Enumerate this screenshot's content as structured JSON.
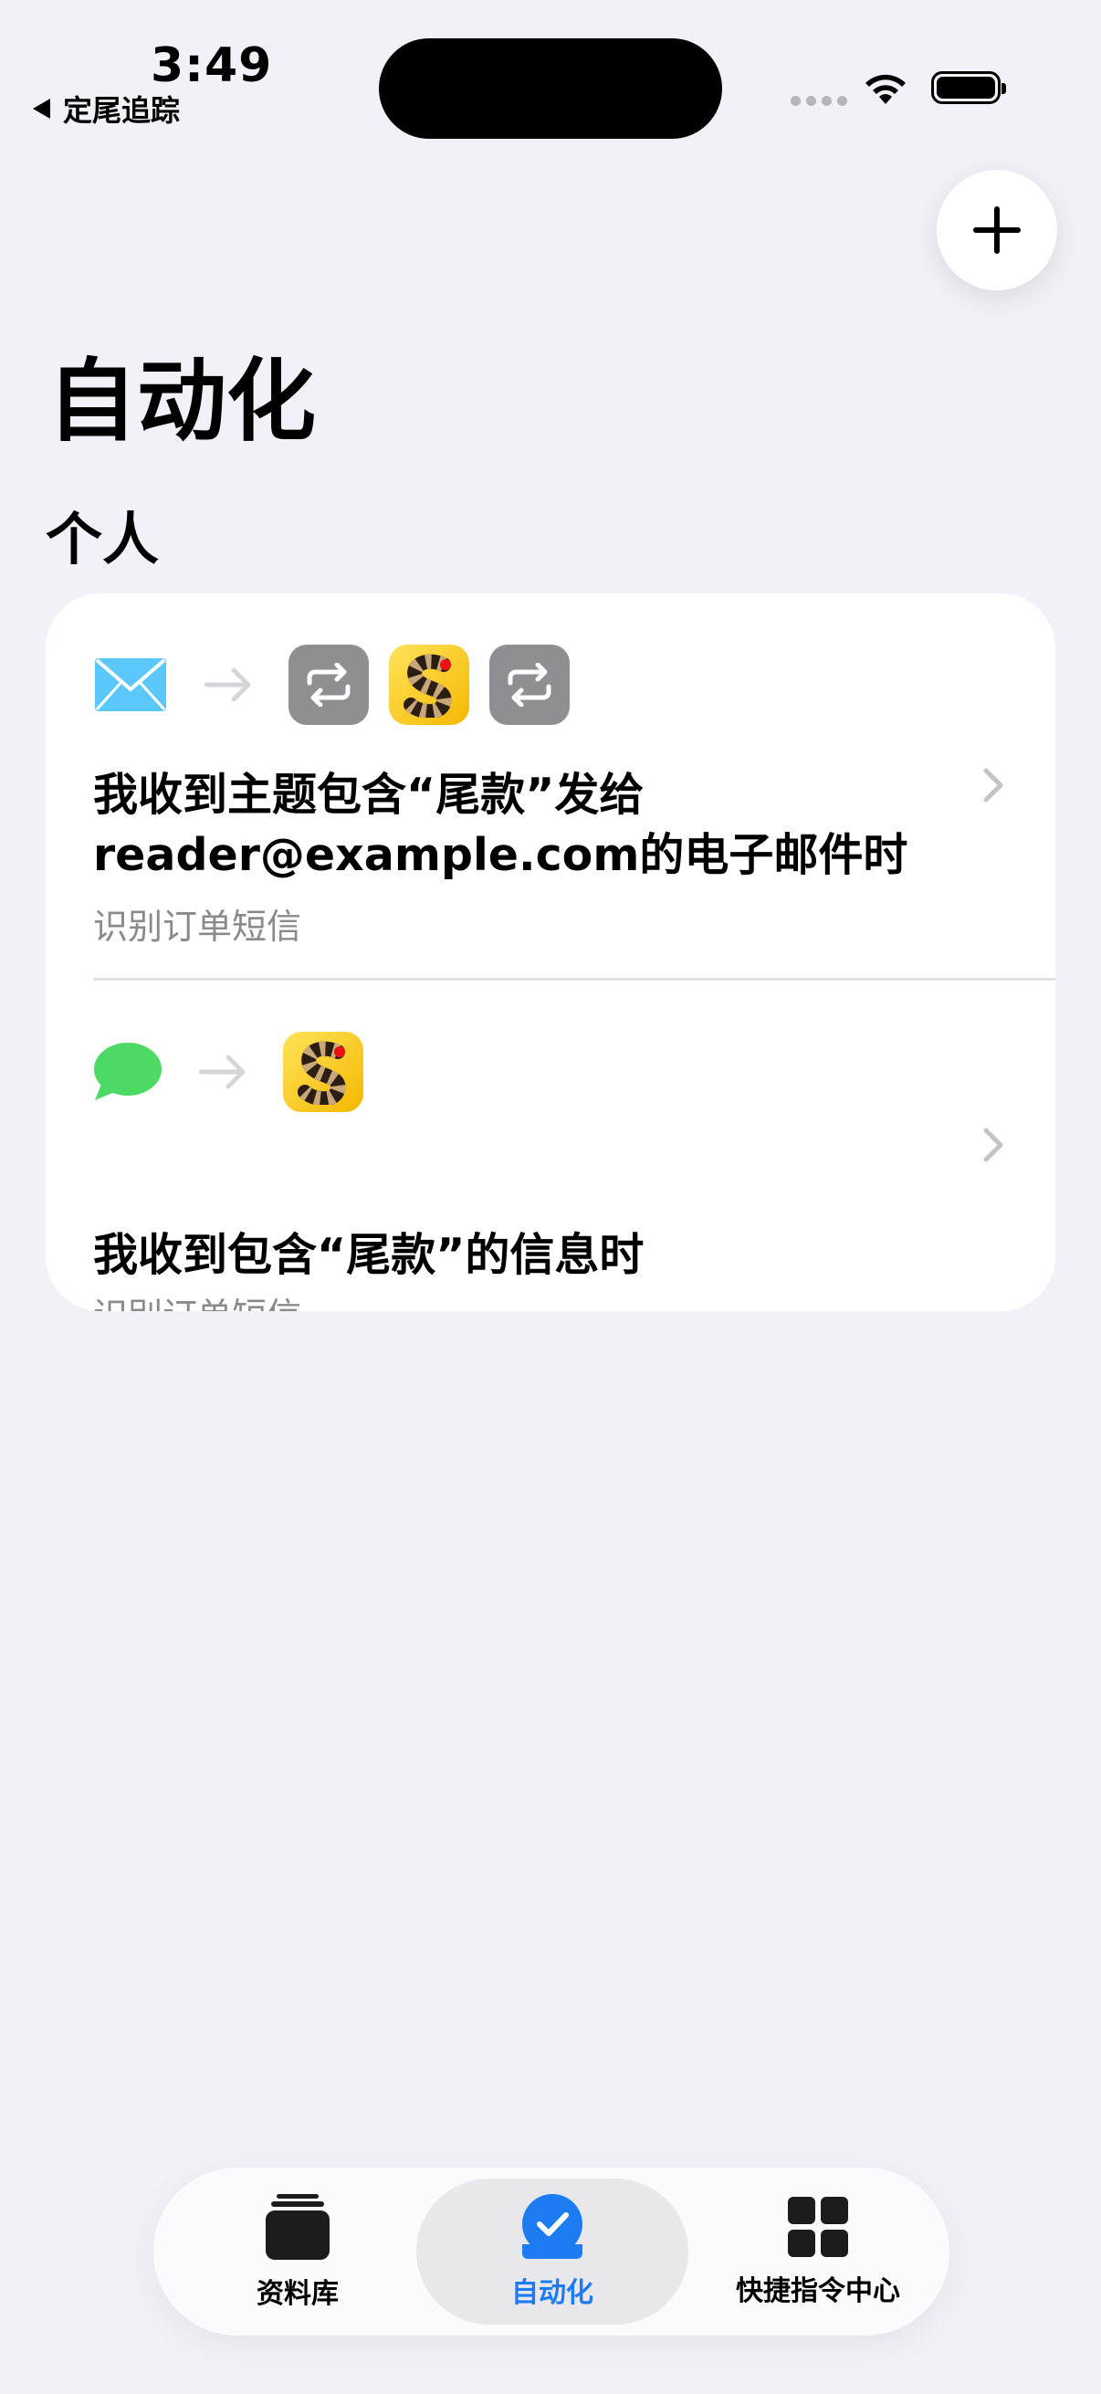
{
  "status_bar": {
    "time": "3:49",
    "back_label": "定尾追踪"
  },
  "header": {
    "title": "自动化",
    "add_icon": "plus-icon"
  },
  "section": {
    "title": "个人"
  },
  "automations": [
    {
      "trigger_icon": "mail-icon",
      "action_icons": [
        "repeat-icon",
        "snake-app-icon",
        "repeat-icon"
      ],
      "title": "我收到主题包含“尾款”发给reader@example.com的电子邮件时",
      "subtitle": "识别订单短信"
    },
    {
      "trigger_icon": "messages-icon",
      "action_icons": [
        "snake-app-icon"
      ],
      "title": "我收到包含“尾款”的信息时",
      "subtitle": "识别订单短信"
    }
  ],
  "tabs": [
    {
      "label": "资料库",
      "icon": "library-icon",
      "selected": false
    },
    {
      "label": "自动化",
      "icon": "automation-check-icon",
      "selected": true
    },
    {
      "label": "快捷指令中心",
      "icon": "gallery-grid-icon",
      "selected": false
    }
  ],
  "colors": {
    "background": "#f2f1f7",
    "accent": "#1d7cf2",
    "subtitle": "#8a8a8e",
    "messages_green": "#4cd964",
    "mail_blue": "#5ac8fa"
  }
}
